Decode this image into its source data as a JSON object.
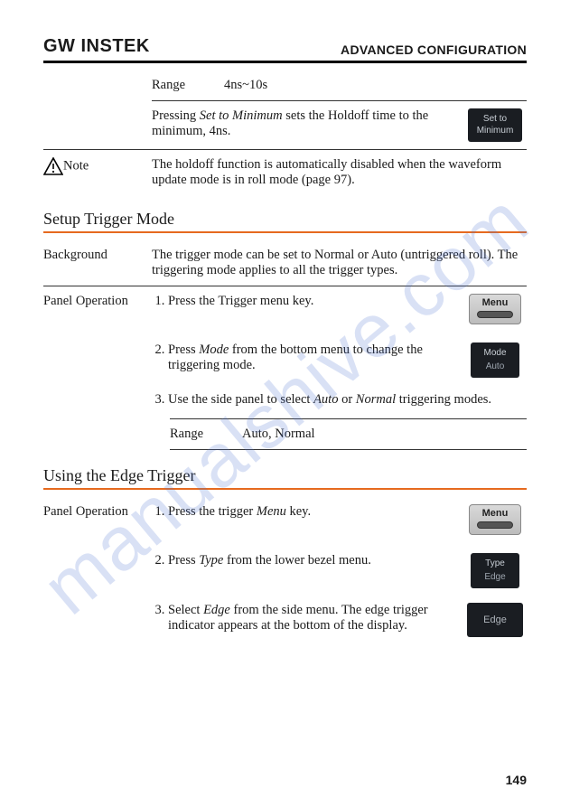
{
  "header": {
    "logo": "GW INSTEK",
    "chapter": "ADVANCED CONFIGURATION"
  },
  "holdoff": {
    "range_label": "Range",
    "range_value": "4ns~10s",
    "min_text_pre": "Pressing ",
    "min_text_em": "Set to Minimum",
    "min_text_post": " sets the Holdoff time to the minimum, 4ns.",
    "softkey_line1": "Set to",
    "softkey_line2": "Minimum",
    "note_label": "Note",
    "note_text": "The holdoff function is automatically disabled when the waveform update mode is in roll mode (page 97)."
  },
  "trigger_mode": {
    "title": "Setup Trigger Mode",
    "bg_label": "Background",
    "bg_text": "The trigger mode can be set to Normal or Auto (untriggered roll).  The triggering mode applies to all the trigger types.",
    "op_label": "Panel Operation",
    "step1": "Press the Trigger menu key.",
    "step2_pre": "Press ",
    "step2_em": "Mode",
    "step2_post": " from the bottom menu to change the triggering mode.",
    "step3_pre": "Use the side panel to select ",
    "step3_em1": "Auto",
    "step3_mid": " or ",
    "step3_em2": "Normal",
    "step3_post": " triggering modes.",
    "range_label": "Range",
    "range_value": "Auto, Normal",
    "menu_key": "Menu",
    "mode_key_label": "Mode",
    "mode_key_value": "Auto"
  },
  "edge": {
    "title": "Using the Edge Trigger",
    "op_label": "Panel Operation",
    "step1_pre": "Press the trigger ",
    "step1_em": "Menu",
    "step1_post": " key.",
    "step2_pre": "Press ",
    "step2_em": "Type",
    "step2_post": " from the lower bezel menu.",
    "step3_pre": "Select ",
    "step3_em": "Edge",
    "step3_post": " from the side menu. The edge trigger indicator appears at the bottom of the display.",
    "menu_key": "Menu",
    "type_key_label": "Type",
    "type_key_value": "Edge",
    "edge_key": "Edge"
  },
  "page_number": "149",
  "watermark": "manualshive.com"
}
